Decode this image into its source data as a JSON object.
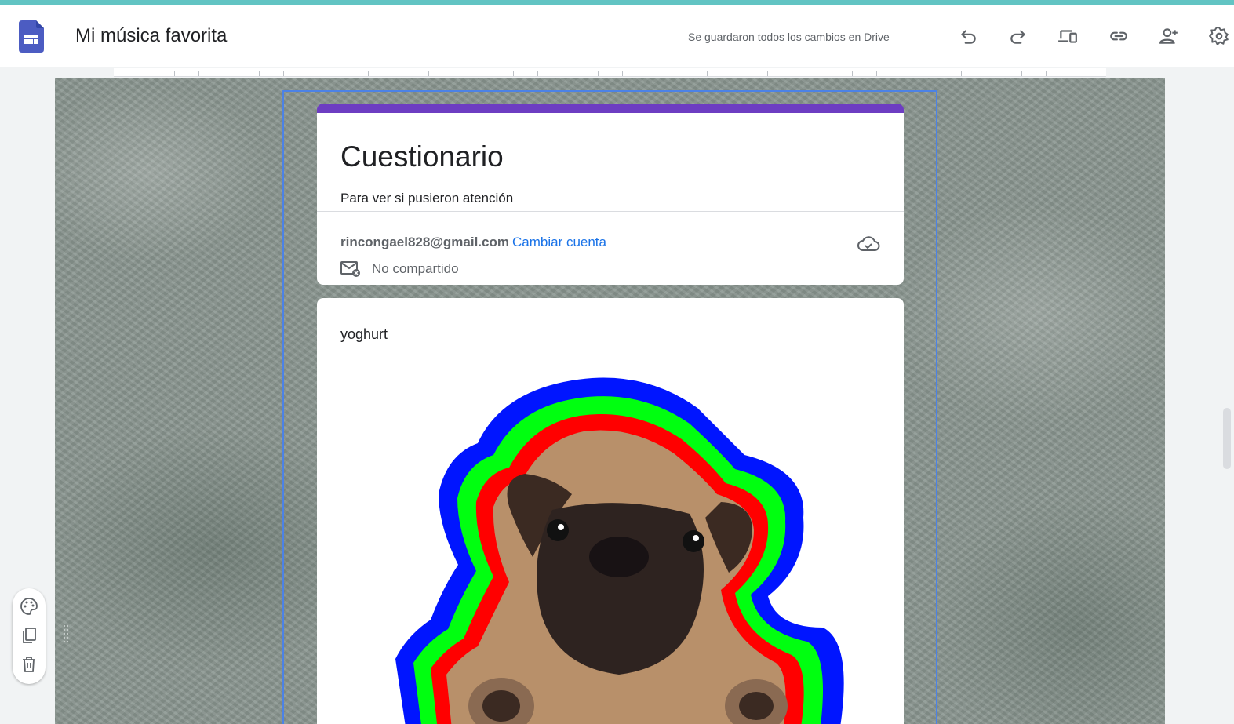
{
  "appbar": {
    "doc_title": "Mi música favorita",
    "save_status": "Se guardaron todos los cambios en Drive",
    "icons": [
      "undo-icon",
      "redo-icon",
      "preview-devices-icon",
      "link-icon",
      "add-person-icon",
      "settings-icon"
    ]
  },
  "form": {
    "title": "Cuestionario",
    "description": "Para ver si pusieron atención",
    "account_email": "rincongael828@gmail.com",
    "switch_account": "Cambiar cuenta",
    "share_status": "No compartido"
  },
  "question": {
    "text": "yoghurt",
    "image_subject": "pug puppy sticker with blue, green and red outlines"
  },
  "side_toolbar": {
    "icons": [
      "palette-icon",
      "duplicate-icon",
      "delete-icon"
    ]
  },
  "colors": {
    "top_stripe": "#62c4c3",
    "form_header_accent": "#6d3dc2",
    "link": "#1a73e8",
    "selection_outline": "#4c82e6",
    "logo": "#4c5cc2"
  }
}
